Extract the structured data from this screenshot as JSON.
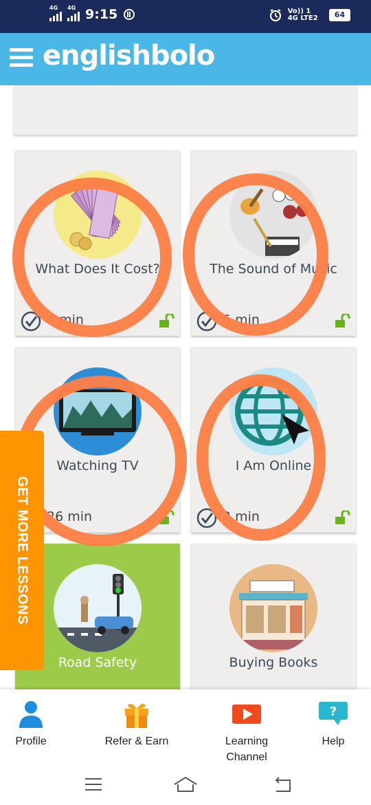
{
  "status_bar": {
    "signal1_label": "4G",
    "signal2_label": "4G",
    "time": "9:15",
    "network_label": "Vo)) 1 4G LTE2",
    "battery": "64"
  },
  "header": {
    "logo": "englishbolo",
    "brand_color": "#4ab7e6"
  },
  "lessons": [
    {
      "title": "What Does It Cost?",
      "duration": "4 min",
      "icon": "rupee-notes-art"
    },
    {
      "title": "The Sound of Music",
      "duration": "5 min",
      "icon": "instruments-art"
    },
    {
      "title": "Watching TV",
      "duration": "26 min",
      "icon": "tv-art"
    },
    {
      "title": "I Am Online",
      "duration": "2 min",
      "icon": "globe-art"
    },
    {
      "title": "Road Safety",
      "duration": "",
      "icon": "traffic-art"
    },
    {
      "title": "Buying Books",
      "duration": "",
      "icon": "bookshop-art"
    }
  ],
  "side_tab": {
    "label": "GET MORE LESSONS",
    "color": "#fd9400"
  },
  "bottom_nav": [
    {
      "label": "Profile",
      "icon": "profile-icon"
    },
    {
      "label": "Refer & Earn",
      "icon": "gift-icon"
    },
    {
      "label": "Learning\nChannel",
      "icon": "play-icon"
    },
    {
      "label": "Help",
      "icon": "help-icon"
    }
  ],
  "colors": {
    "overlay_ring": "#fd7f45",
    "card_bg": "#efeeec",
    "green_card": "#9ccb4a",
    "lock": "#67b51d"
  }
}
